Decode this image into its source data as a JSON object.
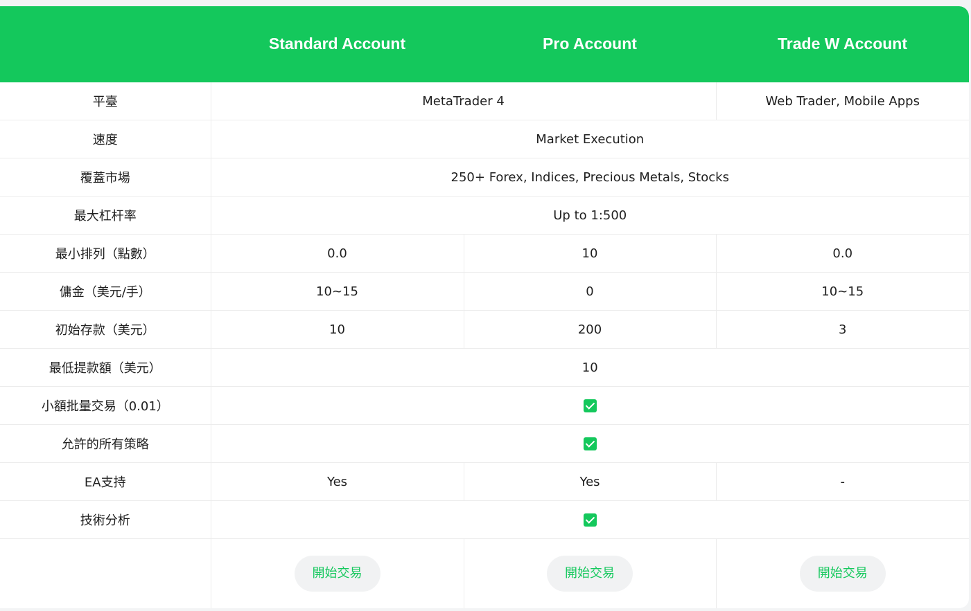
{
  "header": {
    "corner": "",
    "columns": [
      "Standard Account",
      "Pro Account",
      "Trade W Account"
    ]
  },
  "rows": {
    "platform": {
      "label": "平臺",
      "std_pro": "MetaTrader 4",
      "tradew": "Web Trader, Mobile Apps"
    },
    "speed": {
      "label": "速度",
      "all": "Market Execution"
    },
    "markets": {
      "label": "覆蓋市場",
      "all": "250+ Forex, Indices, Precious Metals, Stocks"
    },
    "leverage": {
      "label": "最大杠杆率",
      "all": "Up to 1:500"
    },
    "spread": {
      "label": "最小排列（點數）",
      "standard": "0.0",
      "pro": "10",
      "tradew": "0.0"
    },
    "commission": {
      "label": "傭金（美元/手）",
      "standard": "10~15",
      "pro": "0",
      "tradew": "10~15"
    },
    "deposit": {
      "label": "初始存款（美元）",
      "standard": "10",
      "pro": "200",
      "tradew": "3"
    },
    "withdrawal": {
      "label": "最低提款額（美元）",
      "all": "10"
    },
    "microlot": {
      "label": "小額批量交易（0.01）",
      "all": "check-icon"
    },
    "strategies": {
      "label": "允許的所有策略",
      "all": "check-icon"
    },
    "ea": {
      "label": "EA支持",
      "standard": "Yes",
      "pro": "Yes",
      "tradew": "-"
    },
    "analysis": {
      "label": "技術分析",
      "all": "check-icon"
    }
  },
  "buttons": {
    "standard": "開始交易",
    "pro": "開始交易",
    "tradew": "開始交易"
  },
  "colors": {
    "accent": "#14c85c",
    "button_bg": "#f1f2f3"
  }
}
